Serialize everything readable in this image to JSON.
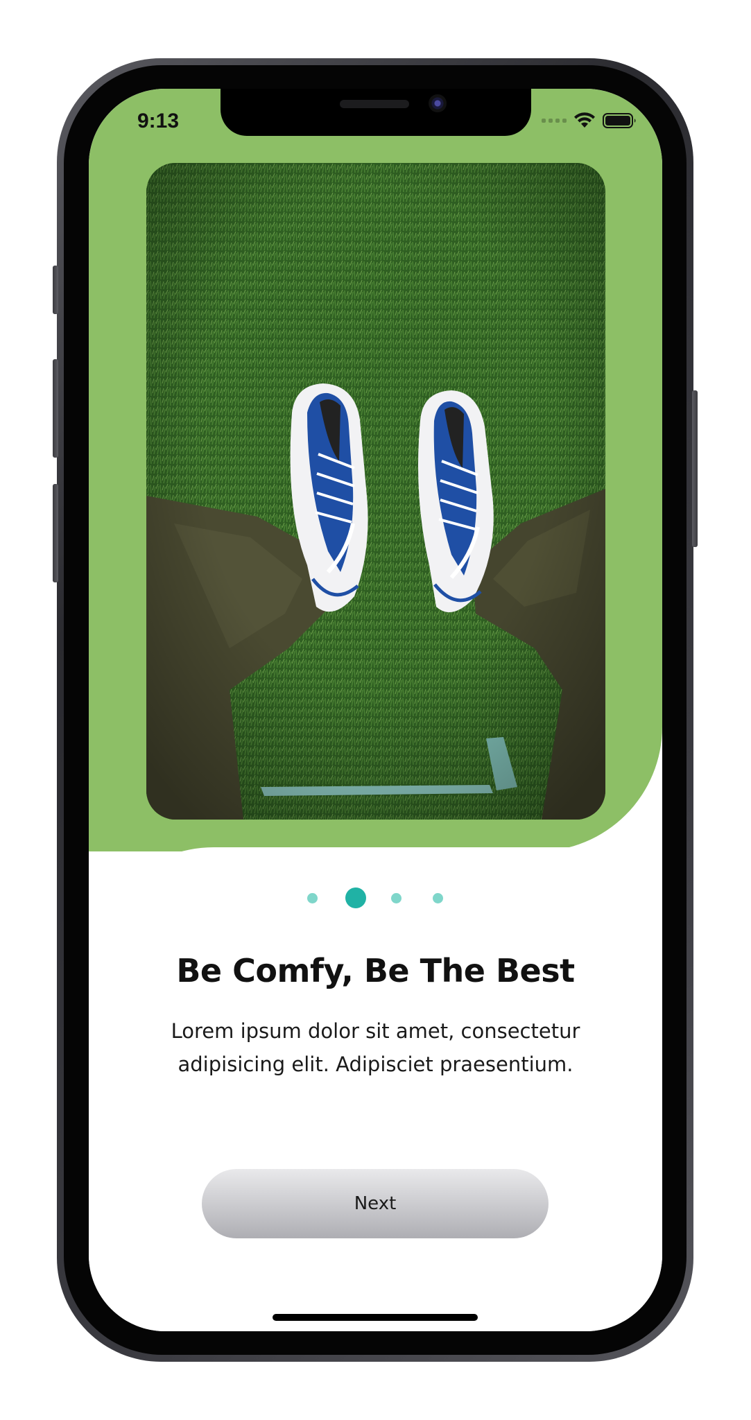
{
  "status_bar": {
    "time": "9:13",
    "icons": [
      "cellular-signal-icon",
      "wifi-icon",
      "battery-icon"
    ]
  },
  "hero": {
    "image": "sneakers-on-grass-photo",
    "background_color": "#8dbf66"
  },
  "pagination": {
    "total": 4,
    "active_index": 1,
    "active_color": "#20b2a5",
    "inactive_color": "#7fd6ca"
  },
  "onboarding": {
    "title": "Be Comfy, Be The Best",
    "description": "Lorem ipsum dolor sit amet, consectetur adipisicing elit. Adipisciet praesentium."
  },
  "actions": {
    "next_label": "Next"
  }
}
